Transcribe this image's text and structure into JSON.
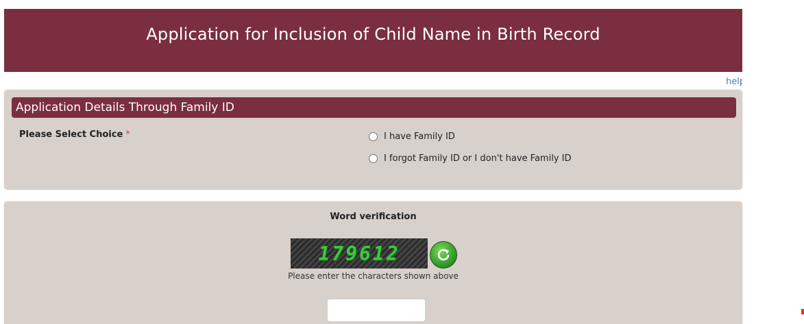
{
  "header": {
    "title": "Application for Inclusion of Child Name in Birth Record"
  },
  "help": {
    "label": "help"
  },
  "family_section": {
    "title": "Application Details Through Family ID",
    "choice_label": "Please Select Choice",
    "required_mark": "*",
    "options": [
      {
        "label": "I have Family ID",
        "selected": false
      },
      {
        "label": "I forgot Family ID or I don't have Family ID",
        "selected": false
      }
    ]
  },
  "verification": {
    "title": "Word verification",
    "captcha_text": "179612",
    "hint": "Please enter the characters shown above",
    "input_value": "",
    "refresh_icon": "refresh-icon"
  },
  "colors": {
    "brand": "#7a2e3f",
    "panel_background": "#d8d0cb",
    "captcha_text": "#3cc93c"
  }
}
